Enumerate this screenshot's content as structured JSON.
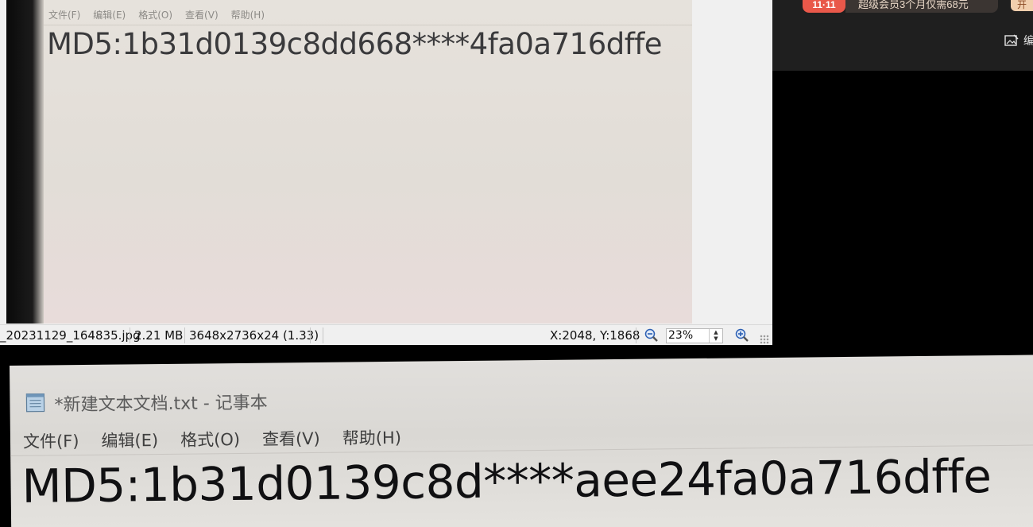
{
  "viewer": {
    "photo_menu": [
      "文件(F)",
      "编辑(E)",
      "格式(O)",
      "查看(V)",
      "帮助(H)"
    ],
    "photo_text": "MD5:1b31d0139c8dd668****4fa0a716dffe",
    "status": {
      "filename": "_20231129_164835.jpg",
      "filesize": "2.21 MB",
      "dimensions": "3648x2736x24 (1.33)",
      "coords": "X:2048, Y:1868",
      "zoom": "23%"
    }
  },
  "promo": {
    "badge": "11·11",
    "text": "超级会员3个月仅需68元",
    "button": "开",
    "edit_label": "编"
  },
  "notepad_photo": {
    "title": "*新建文本文档.txt - 记事本",
    "menu": [
      "文件(F)",
      "编辑(E)",
      "格式(O)",
      "查看(V)",
      "帮助(H)"
    ],
    "text": "MD5:1b31d0139c8d****aee24fa0a716dffe"
  }
}
